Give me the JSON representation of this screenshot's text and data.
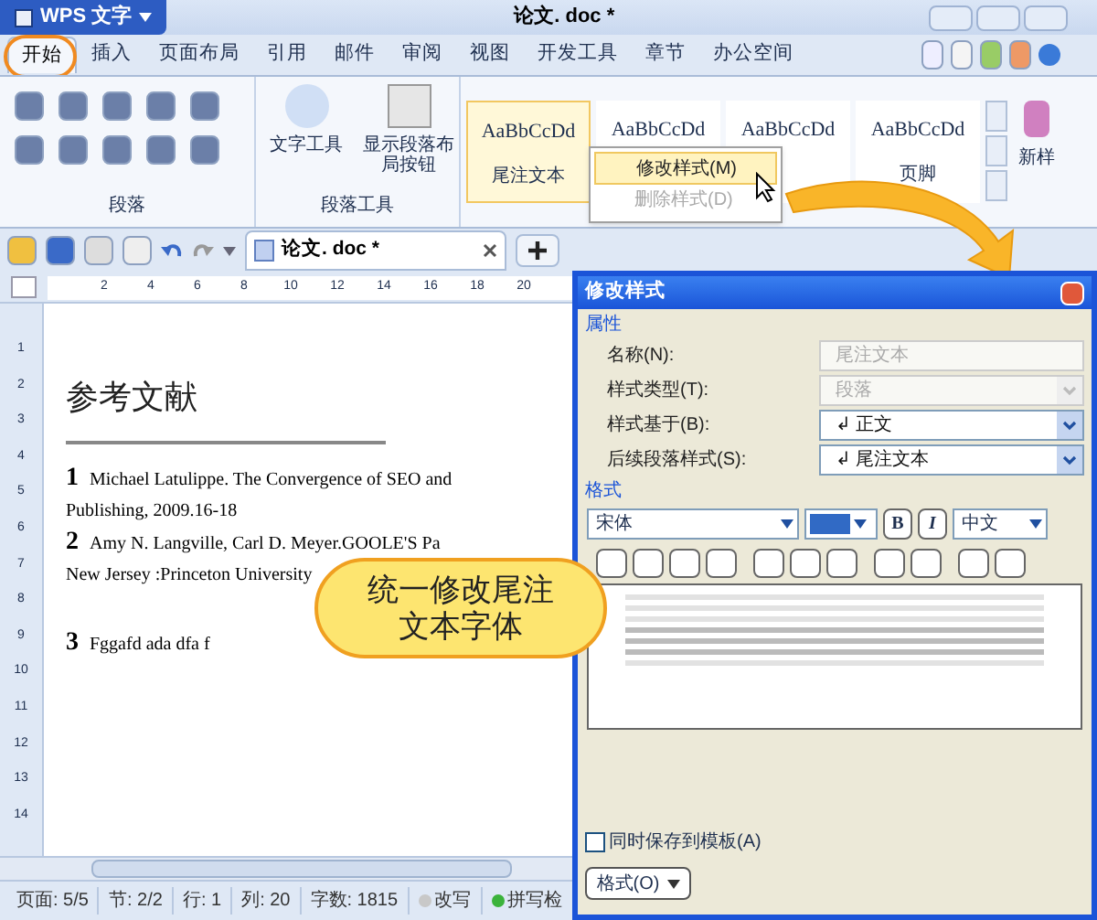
{
  "app_button": {
    "label": "WPS 文字"
  },
  "window": {
    "title": "论文. doc *"
  },
  "ribbon_tabs": [
    {
      "label": "开始",
      "selected": true
    },
    {
      "label": "插入",
      "selected": false
    },
    {
      "label": "页面布局",
      "selected": false
    },
    {
      "label": "引用",
      "selected": false
    },
    {
      "label": "邮件",
      "selected": false
    },
    {
      "label": "审阅",
      "selected": false
    },
    {
      "label": "视图",
      "selected": false
    },
    {
      "label": "开发工具",
      "selected": false
    },
    {
      "label": "章节",
      "selected": false
    },
    {
      "label": "办公空间",
      "selected": false
    }
  ],
  "ribbon": {
    "paragraph_group": {
      "label": "段落"
    },
    "tools_group": {
      "label": "段落工具",
      "buttons": [
        "文字工具",
        "显示段落布局按钮"
      ]
    },
    "styles": [
      {
        "preview": "AaBbCcDd",
        "label": "尾注文本",
        "selected": true
      },
      {
        "preview": "AaBbCcDd",
        "selected": false
      },
      {
        "preview": "AaBbCcDd",
        "selected": false
      },
      {
        "preview": "AaBbCcDd",
        "label": "页脚",
        "selected": false
      }
    ],
    "new_style": "新样"
  },
  "context_menu": [
    {
      "label": "修改样式(M)",
      "selected": true,
      "disabled": false
    },
    {
      "label": "删除样式(D)",
      "selected": false,
      "disabled": true
    }
  ],
  "document_tab": {
    "title": "论文. doc *"
  },
  "ruler": {
    "horizontal": [
      "2",
      "4",
      "6",
      "8",
      "10",
      "12",
      "14",
      "16",
      "18",
      "20"
    ],
    "vertical": [
      "1",
      "2",
      "3",
      "4",
      "5",
      "6",
      "7",
      "8",
      "9",
      "10",
      "11",
      "12",
      "13",
      "14"
    ]
  },
  "document": {
    "heading": "参考文献",
    "endnotes": [
      {
        "number": "1",
        "lines": [
          "Michael Latulippe. The Convergence of SEO and",
          "Publishing, 2009.16-18"
        ]
      },
      {
        "number": "2",
        "lines": [
          "Amy N. Langville, Carl D. Meyer.GOOLE'S Pa",
          "New Jersey :Princeton University"
        ]
      },
      {
        "number": "3",
        "lines": [
          "Fggafd ada dfa f"
        ]
      }
    ]
  },
  "callout": {
    "lines": [
      "统一修改尾注",
      "文本字体"
    ]
  },
  "dialog": {
    "title": "修改样式",
    "properties_label": "属性",
    "fields": [
      {
        "kind": "text",
        "label": "名称(N):",
        "value": "尾注文本",
        "disabled": true
      },
      {
        "kind": "select",
        "label": "样式类型(T):",
        "value": "段落",
        "disabled": true
      },
      {
        "kind": "select",
        "label": "样式基于(B):",
        "value": "↲ 正文",
        "disabled": false
      },
      {
        "kind": "select",
        "label": "后续段落样式(S):",
        "value": "↲ 尾注文本",
        "disabled": false
      }
    ],
    "format_label": "格式",
    "font": "宋体",
    "bold": "B",
    "italic": "I",
    "script": "中文",
    "save_to_template": {
      "label": "同时保存到模板(A)",
      "checked": false
    },
    "format_button": "格式(O)"
  },
  "status_bar": [
    {
      "kind": "text",
      "label": "页面: 5/5"
    },
    {
      "kind": "text",
      "label": "节: 2/2"
    },
    {
      "kind": "text",
      "label": "行: 1"
    },
    {
      "kind": "text",
      "label": "列: 20"
    },
    {
      "kind": "text",
      "label": "字数: 1815"
    },
    {
      "kind": "indicator",
      "label": "改写",
      "on": false
    },
    {
      "kind": "indicator",
      "label": "拼写检",
      "on": true
    }
  ]
}
